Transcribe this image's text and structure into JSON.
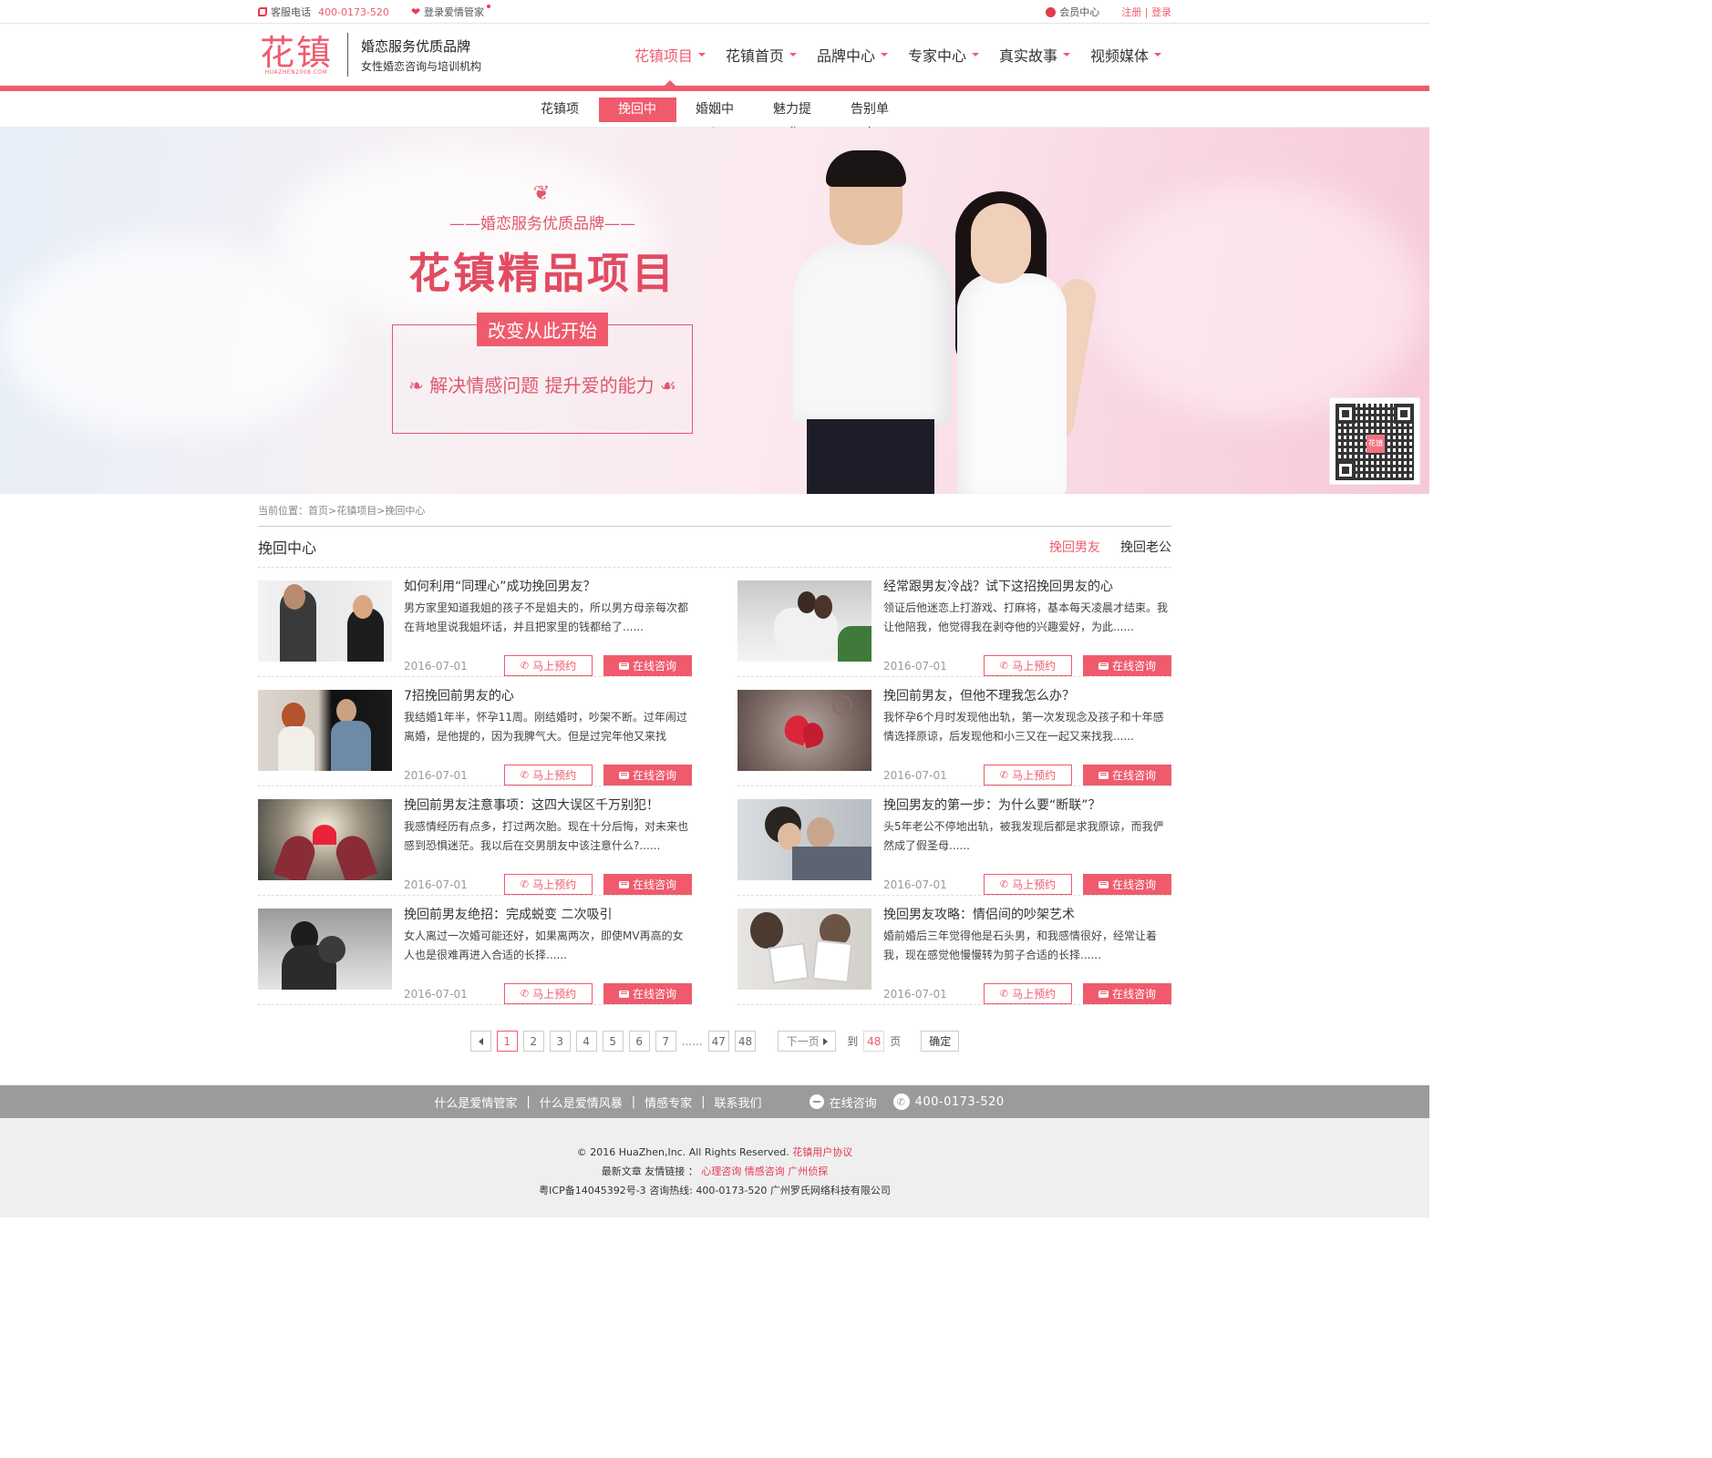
{
  "topbar": {
    "phone_label": "客服电话",
    "phone_number": "400-0173-520",
    "login_manager": "登录爱情管家",
    "member_center": "会员中心",
    "register": "注册",
    "divider": "|",
    "login": "登录"
  },
  "header": {
    "logo_cn": "花镇",
    "logo_en": "HUAZHEN2008.COM",
    "slogan_1": "婚恋服务优质品牌",
    "slogan_2": "女性婚恋咨询与培训机构",
    "nav": [
      {
        "label": "花镇项目",
        "active": true
      },
      {
        "label": "花镇首页"
      },
      {
        "label": "品牌中心"
      },
      {
        "label": "专家中心"
      },
      {
        "label": "真实故事"
      },
      {
        "label": "视频媒体"
      }
    ]
  },
  "subnav": [
    "花镇项目",
    "挽回中心",
    "婚姻中心",
    "魅力提升",
    "告别单身"
  ],
  "subnav_active": "挽回中心",
  "banner": {
    "subtitle": "——婚恋服务优质品牌——",
    "title": "花镇精品项目",
    "badge": "改变从此开始",
    "line": "解决情感问题 提升爱的能力",
    "qr_logo": "花镇"
  },
  "breadcrumb": "当前位置：首页>花镇项目>挽回中心",
  "section": {
    "title": "挽回中心",
    "tabs": [
      {
        "label": "挽回男友",
        "active": true
      },
      {
        "label": "挽回老公"
      }
    ]
  },
  "buttons": {
    "book": "马上预约",
    "chat": "在线咨询"
  },
  "articles": [
    {
      "title": "如何利用“同理心”成功挽回男友？",
      "desc": "男方家里知道我姐的孩子不是姐夫的，所以男方母亲每次都在背地里说我姐坏话，并且把家里的钱都给了......",
      "date": "2016-07-01"
    },
    {
      "title": "经常跟男友冷战？试下这招挽回男友的心",
      "desc": "领证后他迷恋上打游戏、打麻将，基本每天凌晨才结束。我让他陪我，他觉得我在剥夺他的兴趣爱好，为此......",
      "date": "2016-07-01"
    },
    {
      "title": "7招挽回前男友的心",
      "desc": "我结婚1年半，怀孕11周。刚结婚时，吵架不断。过年闹过离婚，是他提的，因为我脾气大。但是过完年他又来找我......",
      "date": "2016-07-01"
    },
    {
      "title": "挽回前男友，但他不理我怎么办？",
      "desc": "我怀孕6个月时发现他出轨，第一次发现念及孩子和十年感情选择原谅，后发现他和小三又在一起又来找我......",
      "date": "2016-07-01"
    },
    {
      "title": "挽回前男友注意事项：这四大误区千万别犯！",
      "desc": "我感情经历有点多，打过两次胎。现在十分后悔，对未来也感到恐惧迷茫。我以后在交男朋友中该注意什么?......",
      "date": "2016-07-01"
    },
    {
      "title": "挽回男友的第一步：为什么要“断联”？",
      "desc": "头5年老公不停地出轨，被我发现后都是求我原谅，而我俨然成了假圣母......",
      "date": "2016-07-01"
    },
    {
      "title": "挽回前男友绝招：完成蜕变 二次吸引",
      "desc": "女人离过一次婚可能还好，如果离两次，即使MV再高的女人也是很难再进入合适的长择......",
      "date": "2016-07-01"
    },
    {
      "title": "挽回男友攻略：情侣间的吵架艺术",
      "desc": "婚前婚后三年觉得他是石头男，和我感情很好，经常让着我，现在感觉他慢慢转为剪子合适的长择......",
      "date": "2016-07-01"
    }
  ],
  "pagination": {
    "pages": [
      "1",
      "2",
      "3",
      "4",
      "5",
      "6",
      "7"
    ],
    "ellipsis": "......",
    "last_pages": [
      "47",
      "48"
    ],
    "next": "下一页",
    "goto_label": "到",
    "goto_value": "48",
    "page_unit": "页",
    "confirm": "确定",
    "current": 1
  },
  "footbar": {
    "links": [
      "什么是爱情管家",
      "什么是爱情风暴",
      "情感专家",
      "联系我们"
    ],
    "separator": "|",
    "chat": "在线咨询",
    "phone": "400-0173-520"
  },
  "footer": {
    "copyright": "© 2016 HuaZhen,Inc. All Rights Reserved.",
    "agreement": "花镇用户协议",
    "latest": "最新文章",
    "friend_links": "友情链接 ：",
    "links": [
      "心理咨询",
      "情感咨询",
      "广州侦探"
    ],
    "icp": "粤ICP备14045392号-3",
    "hotline": "咨询热线: 400-0173-520",
    "company": "广州罗氏网络科技有限公司"
  },
  "colors": {
    "accent": "#ef5b6d",
    "footbar": "#9b9b9b",
    "footer_bg": "#efefef"
  }
}
